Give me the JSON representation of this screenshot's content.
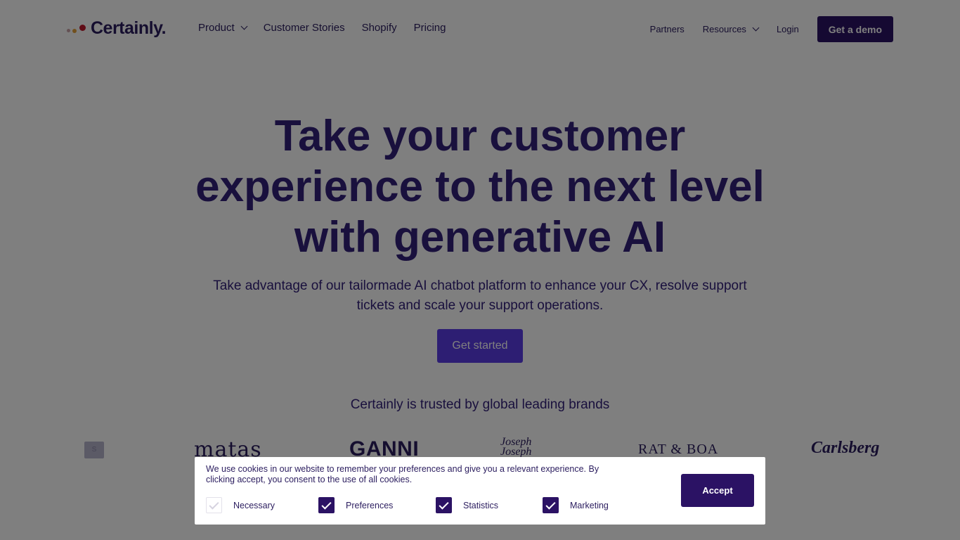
{
  "header": {
    "logo_text": "Certainly.",
    "nav_left": {
      "product": "Product",
      "customer_stories": "Customer Stories",
      "shopify": "Shopify",
      "pricing": "Pricing"
    },
    "nav_right": {
      "partners": "Partners",
      "resources": "Resources",
      "login": "Login",
      "demo": "Get a demo"
    }
  },
  "hero": {
    "title_line1": "Take your customer",
    "title_line2": "experience to the next level",
    "title_line3": "with generative AI",
    "subtitle": "Take advantage of our tailormade AI chatbot platform to enhance your CX, resolve support tickets and scale your support operations.",
    "cta": "Get started"
  },
  "brands": {
    "heading": "Certainly is trusted by global leading brands",
    "logos": {
      "partial": "S",
      "matas": "matas",
      "ganni": "GANNI",
      "joseph_1": "Joseph",
      "joseph_2": "Joseph",
      "ratboa": "RAT & BOA",
      "carlsberg": "Carlsberg"
    }
  },
  "cookie": {
    "text": "We use cookies in our website to remember your preferences and give you a relevant experience. By clicking accept, you consent to the use of all cookies.",
    "options": {
      "necessary": "Necessary",
      "preferences": "Preferences",
      "statistics": "Statistics",
      "marketing": "Marketing"
    },
    "accept": "Accept"
  },
  "colors": {
    "brand_dark": "#2b1264",
    "brand_primary": "#5b3de6",
    "text": "#33207a"
  }
}
